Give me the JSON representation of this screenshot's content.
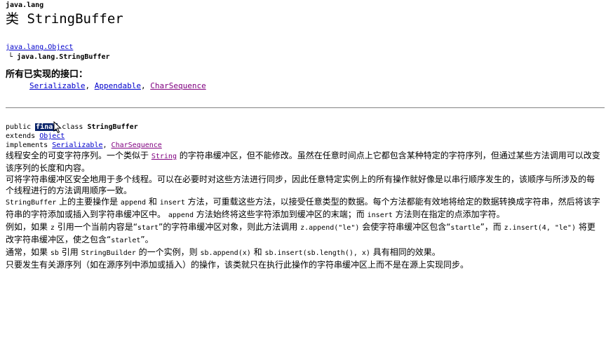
{
  "header": {
    "package": "java.lang",
    "title_prefix": "类",
    "class_name": "StringBuffer"
  },
  "hierarchy": {
    "parent": "java.lang.Object",
    "child_branch": "└",
    "child": "java.lang.StringBuffer"
  },
  "interfaces": {
    "heading": "所有已实现的接口：",
    "items": [
      "Serializable",
      "Appendable",
      "CharSequence"
    ],
    "separator": ", "
  },
  "declaration": {
    "modifier_public": "public",
    "modifier_final": "final",
    "keyword_class": "class",
    "class_name": "StringBuffer",
    "keyword_extends": "extends",
    "superclass": "Object",
    "keyword_implements": "implements",
    "implements_items": [
      "Serializable",
      "CharSequence"
    ],
    "separator": ", "
  },
  "description": {
    "p1_a": "线程安全的可变字符序列。一个类似于",
    "p1_link": "String",
    "p1_b": "的字符串缓冲区，但不能修改。虽然在任意时间点上它都包含某种特定的字符序列，但通过某些方法调用可以改变该序列的长度和内容。",
    "p2": "可将字符串缓冲区安全地用于多个线程。可以在必要时对这些方法进行同步，因此任意特定实例上的所有操作就好像是以串行顺序发生的，该顺序与所涉及的每个线程进行的方法调用顺序一致。",
    "p3_c1": "StringBuffer",
    "p3_a": "上的主要操作是",
    "p3_c2": "append",
    "p3_b": "和",
    "p3_c3": "insert",
    "p3_c": "方法，可重载这些方法，以接受任意类型的数据。每个方法都能有效地将给定的数据转换成字符串，然后将该字符串的字符添加或插入到字符串缓冲区中。",
    "p3_c4": "append",
    "p3_d": "方法始终将这些字符添加到缓冲区的末端；而",
    "p3_c5": "insert",
    "p3_e": "方法则在指定的点添加字符。",
    "p4_a": "例如，如果",
    "p4_c1": "z",
    "p4_b": "引用一个当前内容是“",
    "p4_c2": "start",
    "p4_c": "”的字符串缓冲区对象，则此方法调用",
    "p4_c3": "z.append(\"le\")",
    "p4_d": "会使字符串缓冲区包含“",
    "p4_c4": "startle",
    "p4_e": "”，而",
    "p4_c5": "z.insert(4, \"le\")",
    "p4_f": "将更改字符串缓冲区，使之包含“",
    "p4_c6": "starlet",
    "p4_g": "”。",
    "p5_a": "通常，如果",
    "p5_c1": "sb",
    "p5_b": "引用",
    "p5_c2": "StringBuilder",
    "p5_c": "的一个实例，则",
    "p5_c3": "sb.append(x)",
    "p5_d": "和",
    "p5_c4": "sb.insert(sb.length(), x)",
    "p5_e": "具有相同的效果。",
    "p6": "只要发生有关源序列（如在源序列中添加或插入）的操作，该类就只在执行此操作的字符串缓冲区上而不是在源上实现同步。"
  },
  "colors": {
    "link": "#0000cc",
    "visited_link": "#800080",
    "selection": "#0a246a",
    "rule": "#9a9a9a"
  }
}
